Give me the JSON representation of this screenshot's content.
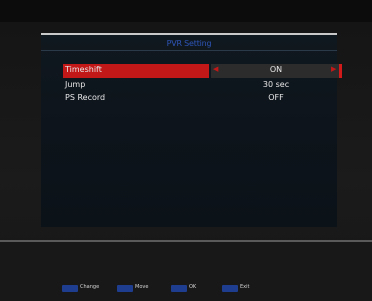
{
  "dialog": {
    "title": "PVR Setting",
    "settings": [
      {
        "label": "Timeshift",
        "value": "ON",
        "selected": true
      },
      {
        "label": "Jump",
        "value": "30 sec",
        "selected": false
      },
      {
        "label": "PS Record",
        "value": "OFF",
        "selected": false
      }
    ]
  },
  "hints": [
    {
      "label": "Change",
      "icon": "blue-key-icon"
    },
    {
      "label": "Move",
      "icon": "blue-key-icon"
    },
    {
      "label": "OK",
      "icon": "blue-key-icon"
    },
    {
      "label": "Exit",
      "icon": "blue-key-icon"
    }
  ],
  "colors": {
    "title": "#2e54b6",
    "selection": "#c21818",
    "key": "#1f3d8f",
    "background": "#161616"
  }
}
